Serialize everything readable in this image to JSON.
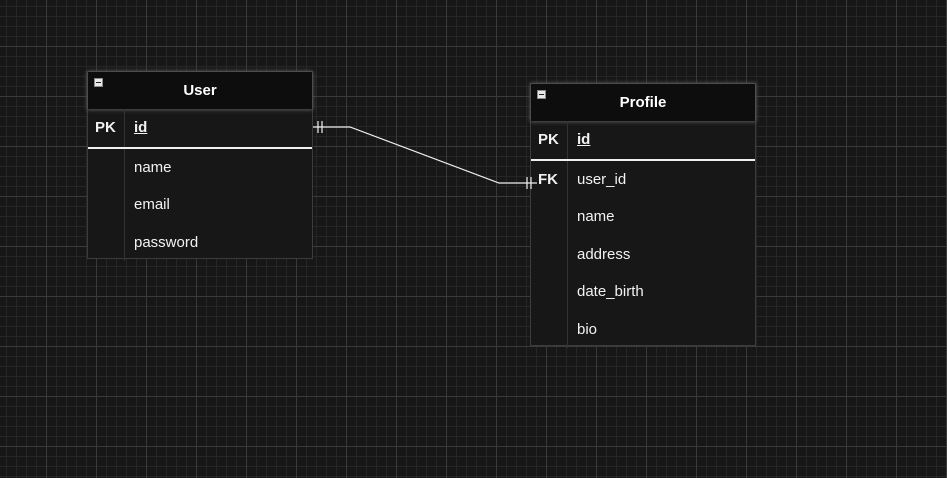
{
  "entities": {
    "user": {
      "title": "User",
      "pk_label": "PK",
      "pk_field": "id",
      "fields": [
        "name",
        "email",
        "password"
      ]
    },
    "profile": {
      "title": "Profile",
      "pk_label": "PK",
      "pk_field": "id",
      "fk_label": "FK",
      "fk_field": "user_id",
      "fields": [
        "name",
        "address",
        "date_birth",
        "bio"
      ]
    }
  },
  "relationship": {
    "from": "User.id",
    "to": "Profile.user_id",
    "cardinality": "one-to-one"
  }
}
